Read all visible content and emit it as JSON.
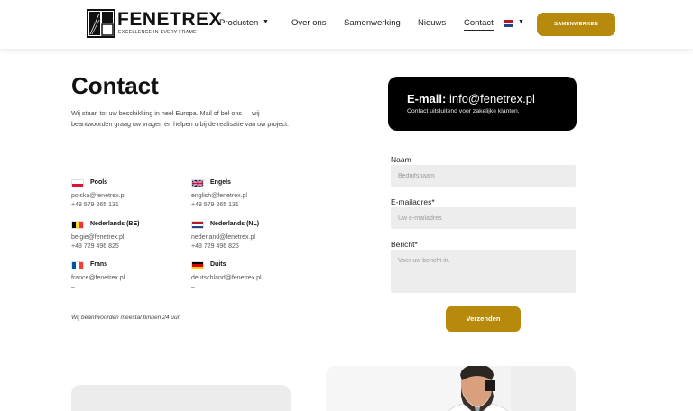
{
  "brand": {
    "name": "FENETREX",
    "tagline": "EXCELLENCE IN EVERY FRAME"
  },
  "nav": {
    "items": [
      {
        "label": "Producten",
        "has_dropdown": true
      },
      {
        "label": "Over ons"
      },
      {
        "label": "Samenwerking"
      },
      {
        "label": "Nieuws"
      },
      {
        "label": "Contact",
        "active": true
      }
    ],
    "language_flag": "nl-flag-icon",
    "cta_label": "SAMENWERKEN"
  },
  "contact": {
    "title": "Contact",
    "intro": "Wij staan tot uw beschikking in heel Europa. Mail of bel ons — wij beantwoorden graag uw vragen en helpen u bij de realisatie van uw project.",
    "offices": [
      {
        "name": "Pools",
        "flag": "pl-flag-icon",
        "email": "polska@fenetrex.pl",
        "phone": "+48 579 265 131"
      },
      {
        "name": "Engels",
        "flag": "uk-flag-icon",
        "email": "english@fenetrex.pl",
        "phone": "+48 579 265 131"
      },
      {
        "name": "Nederlands (BE)",
        "flag": "be-flag-icon",
        "email": "belgie@fenetrex.pl",
        "phone": "+48 729 496 825"
      },
      {
        "name": "Nederlands (NL)",
        "flag": "nl-flag-icon",
        "email": "nederland@fenetrex.pl",
        "phone": "+48 729 496 825"
      },
      {
        "name": "Frans",
        "flag": "fr-flag-icon",
        "email": "france@fenetrex.pl",
        "phone": "–"
      },
      {
        "name": "Duits",
        "flag": "de-flag-icon",
        "email": "deutschland@fenetrex.pl",
        "phone": "–"
      }
    ],
    "note": "Wij beantwoorden meestal binnen 24 uur."
  },
  "email_card": {
    "label": "E-mail:",
    "address": "info@fenetrex.pl",
    "subtext": "Contact uitsluitend voor zakelijke klanten."
  },
  "form": {
    "name_label": "Naam",
    "name_placeholder": "Bedrijfsnaam",
    "email_label": "E-mailadres*",
    "email_placeholder": "Uw e-mailadres",
    "message_label": "Bericht*",
    "message_placeholder": "Voer uw bericht in.",
    "submit_label": "Verzenden"
  },
  "colors": {
    "accent": "#b78a0e",
    "email_card_bg": "#000000",
    "field_bg": "#ededed"
  }
}
